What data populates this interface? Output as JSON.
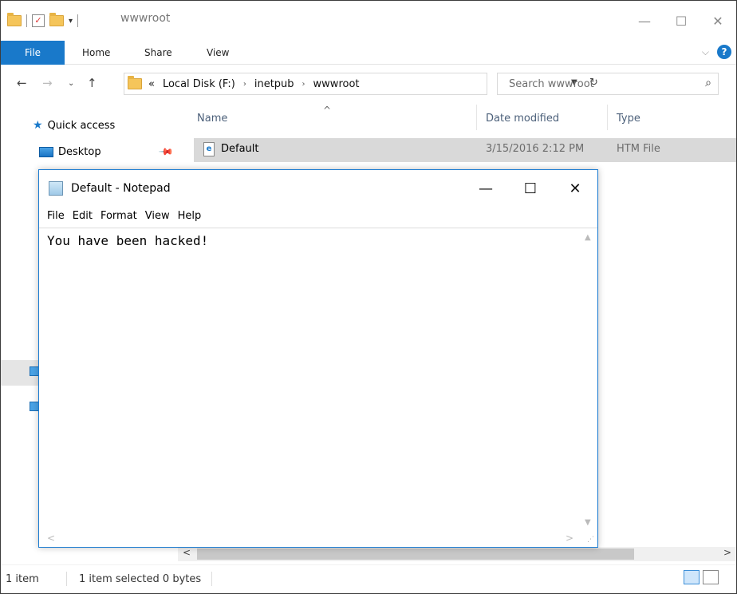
{
  "explorer": {
    "title": "wwwroot",
    "ribbon": {
      "file": "File",
      "home": "Home",
      "share": "Share",
      "view": "View"
    },
    "address": {
      "crumbs": [
        "Local Disk (F:)",
        "inetpub",
        "wwwroot"
      ],
      "chevron": "«",
      "sep": "›"
    },
    "search": {
      "placeholder": "Search wwwroot"
    },
    "nav_pane": {
      "quick_access": "Quick access",
      "desktop": "Desktop"
    },
    "columns": {
      "name": "Name",
      "date": "Date modified",
      "type": "Type"
    },
    "files": [
      {
        "name": "Default",
        "date": "3/15/2016 2:12 PM",
        "type": "HTM File"
      }
    ],
    "status": {
      "count": "1 item",
      "selected": "1 item selected  0 bytes"
    }
  },
  "notepad": {
    "title": "Default - Notepad",
    "menu": [
      "File",
      "Edit",
      "Format",
      "View",
      "Help"
    ],
    "content": "You have been hacked!"
  },
  "colors": {
    "accent": "#1979ca",
    "selection": "#d9d9d9"
  }
}
